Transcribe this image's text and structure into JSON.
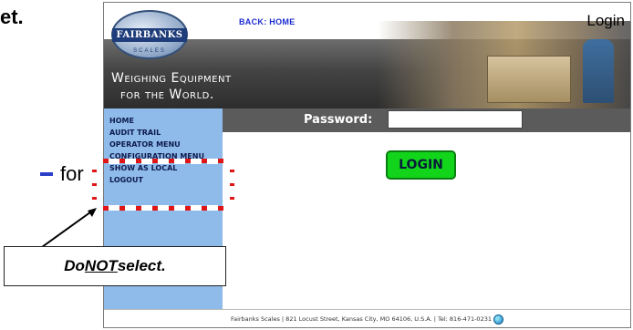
{
  "slide": {
    "frag_top": "et.",
    "frag_mid": "for"
  },
  "header": {
    "back_link": "BACK: HOME",
    "page_title": "Login",
    "logo_text": "FAIRBANKS",
    "logo_sub": "SCALES",
    "tagline_line1": "Weighing Equipment",
    "tagline_line2": "for the World."
  },
  "sidebar": {
    "items": [
      {
        "label": "HOME"
      },
      {
        "label": "AUDIT TRAIL"
      },
      {
        "label": "OPERATOR MENU"
      },
      {
        "label": "CONFIGURATION MENU"
      },
      {
        "label": "SHOW AS LOCAL"
      },
      {
        "label": "LOGOUT"
      }
    ]
  },
  "form": {
    "password_label": "Password:",
    "password_value": "",
    "login_button": "LOGIN"
  },
  "footer": {
    "text": "Fairbanks Scales | 821 Locust Street, Kansas City, MO 64106, U.S.A. | Tel: 816-471-0231"
  },
  "annotation": {
    "callout_pre": "Do ",
    "callout_emph": "NOT",
    "callout_post": " select.",
    "box_color": "#e01616"
  },
  "colors": {
    "sidebar_bg": "#8fbbea",
    "password_bar": "#5b5b5b",
    "login_button": "#11d41b",
    "link": "#1a2bd0"
  }
}
